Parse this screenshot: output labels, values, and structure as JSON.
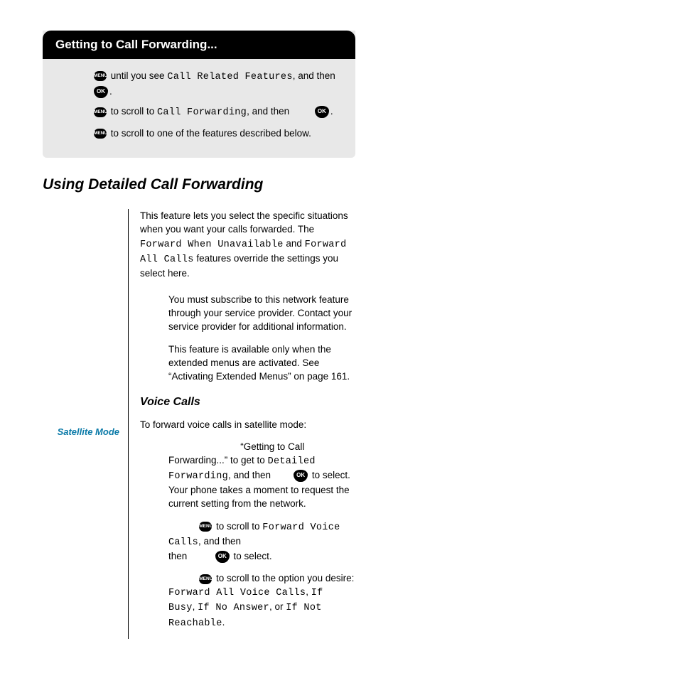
{
  "panel": {
    "title": "Getting to Call Forwarding...",
    "line1_a": " until you see ",
    "line1_menu": "Call Related Features",
    "line1_b": ", and then ",
    "line1_c": ".",
    "line2_a": " to scroll to ",
    "line2_menu": "Call Forwarding",
    "line2_b": ", and then ",
    "line2_c": ".",
    "line3": " to scroll to one of the features described below."
  },
  "section": {
    "title": "Using Detailed Call Forwarding",
    "intro_a": "This feature lets you select the specific situations when you want your calls forwarded. The ",
    "intro_menu1": "Forward When Unavailable",
    "intro_b": " and ",
    "intro_menu2": "Forward All Calls",
    "intro_c": " features override the settings you select here.",
    "note1": "You must subscribe to this network feature through your service provider. Contact your service provider for additional information.",
    "note2": "This feature is available only when the extended menus are activated. See “Activating Extended Menus” on page 161.",
    "voice_title": "Voice Calls",
    "margin_label": "Satellite Mode",
    "voice_intro": "To forward voice calls in satellite mode:",
    "step1_a": "“Getting to Call Forwarding...” to get to ",
    "step1_menu": "Detailed Forwarding",
    "step1_b": ", and then ",
    "step1_c": " to select. Your phone takes a moment to request the current setting from the network.",
    "step2_a": " to scroll to ",
    "step2_menu": "Forward Voice Calls",
    "step2_b": ", and then ",
    "step2_c": " to select.",
    "step3_a": " to scroll to the option you desire: ",
    "step3_menu1": "Forward All Voice Calls",
    "step3_b": ", ",
    "step3_menu2": "If Busy",
    "step3_c": ", ",
    "step3_menu3": "If No Answer",
    "step3_d": ", or ",
    "step3_menu4": "If Not Reachable",
    "step3_e": "."
  },
  "badges": {
    "menu": "MENU",
    "ok": "OK"
  }
}
